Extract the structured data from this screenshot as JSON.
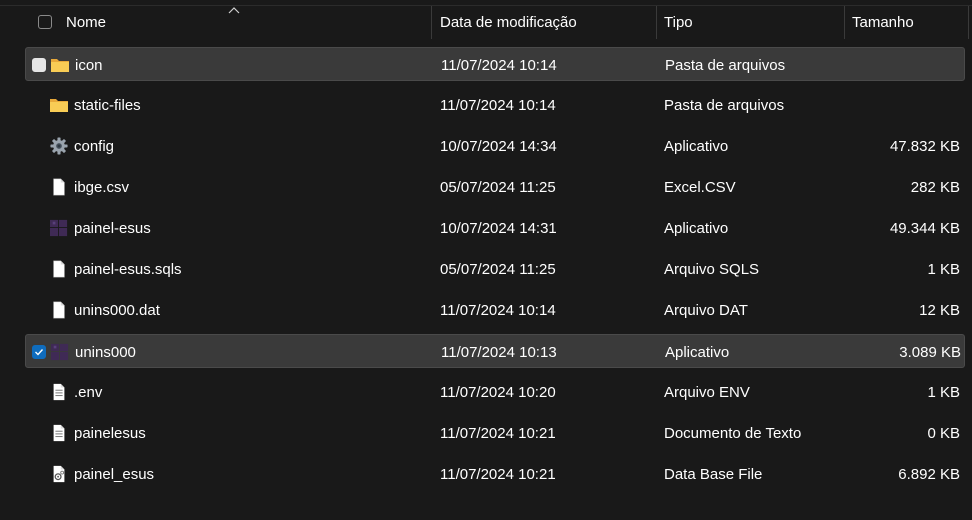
{
  "header": {
    "name": "Nome",
    "date": "Data de modificação",
    "type": "Tipo",
    "size": "Tamanho"
  },
  "files": [
    {
      "name": "icon",
      "date": "11/07/2024 10:14",
      "type": "Pasta de arquivos",
      "size": "",
      "icon": "folder-icon",
      "state": "hover"
    },
    {
      "name": "static-files",
      "date": "11/07/2024 10:14",
      "type": "Pasta de arquivos",
      "size": "",
      "icon": "folder-icon",
      "state": "none"
    },
    {
      "name": "config",
      "date": "10/07/2024 14:34",
      "type": "Aplicativo",
      "size": "47.832 KB",
      "icon": "gear-icon",
      "state": "none"
    },
    {
      "name": "ibge.csv",
      "date": "05/07/2024 11:25",
      "type": "Excel.CSV",
      "size": "282 KB",
      "icon": "file-icon",
      "state": "none"
    },
    {
      "name": "painel-esus",
      "date": "10/07/2024 14:31",
      "type": "Aplicativo",
      "size": "49.344 KB",
      "icon": "app-icon",
      "state": "none"
    },
    {
      "name": "painel-esus.sqls",
      "date": "05/07/2024 11:25",
      "type": "Arquivo SQLS",
      "size": "1 KB",
      "icon": "file-icon",
      "state": "none"
    },
    {
      "name": "unins000.dat",
      "date": "11/07/2024 10:14",
      "type": "Arquivo DAT",
      "size": "12 KB",
      "icon": "file-icon",
      "state": "none"
    },
    {
      "name": "unins000",
      "date": "11/07/2024 10:13",
      "type": "Aplicativo",
      "size": "3.089 KB",
      "icon": "app-icon",
      "state": "checked"
    },
    {
      "name": ".env",
      "date": "11/07/2024 10:20",
      "type": "Arquivo ENV",
      "size": "1 KB",
      "icon": "text-file-icon",
      "state": "none"
    },
    {
      "name": "painelesus",
      "date": "11/07/2024 10:21",
      "type": "Documento de Texto",
      "size": "0 KB",
      "icon": "text-file-icon",
      "state": "none"
    },
    {
      "name": "painel_esus",
      "date": "11/07/2024 10:21",
      "type": "Data Base File",
      "size": "6.892 KB",
      "icon": "settings-file-icon",
      "state": "none"
    }
  ]
}
